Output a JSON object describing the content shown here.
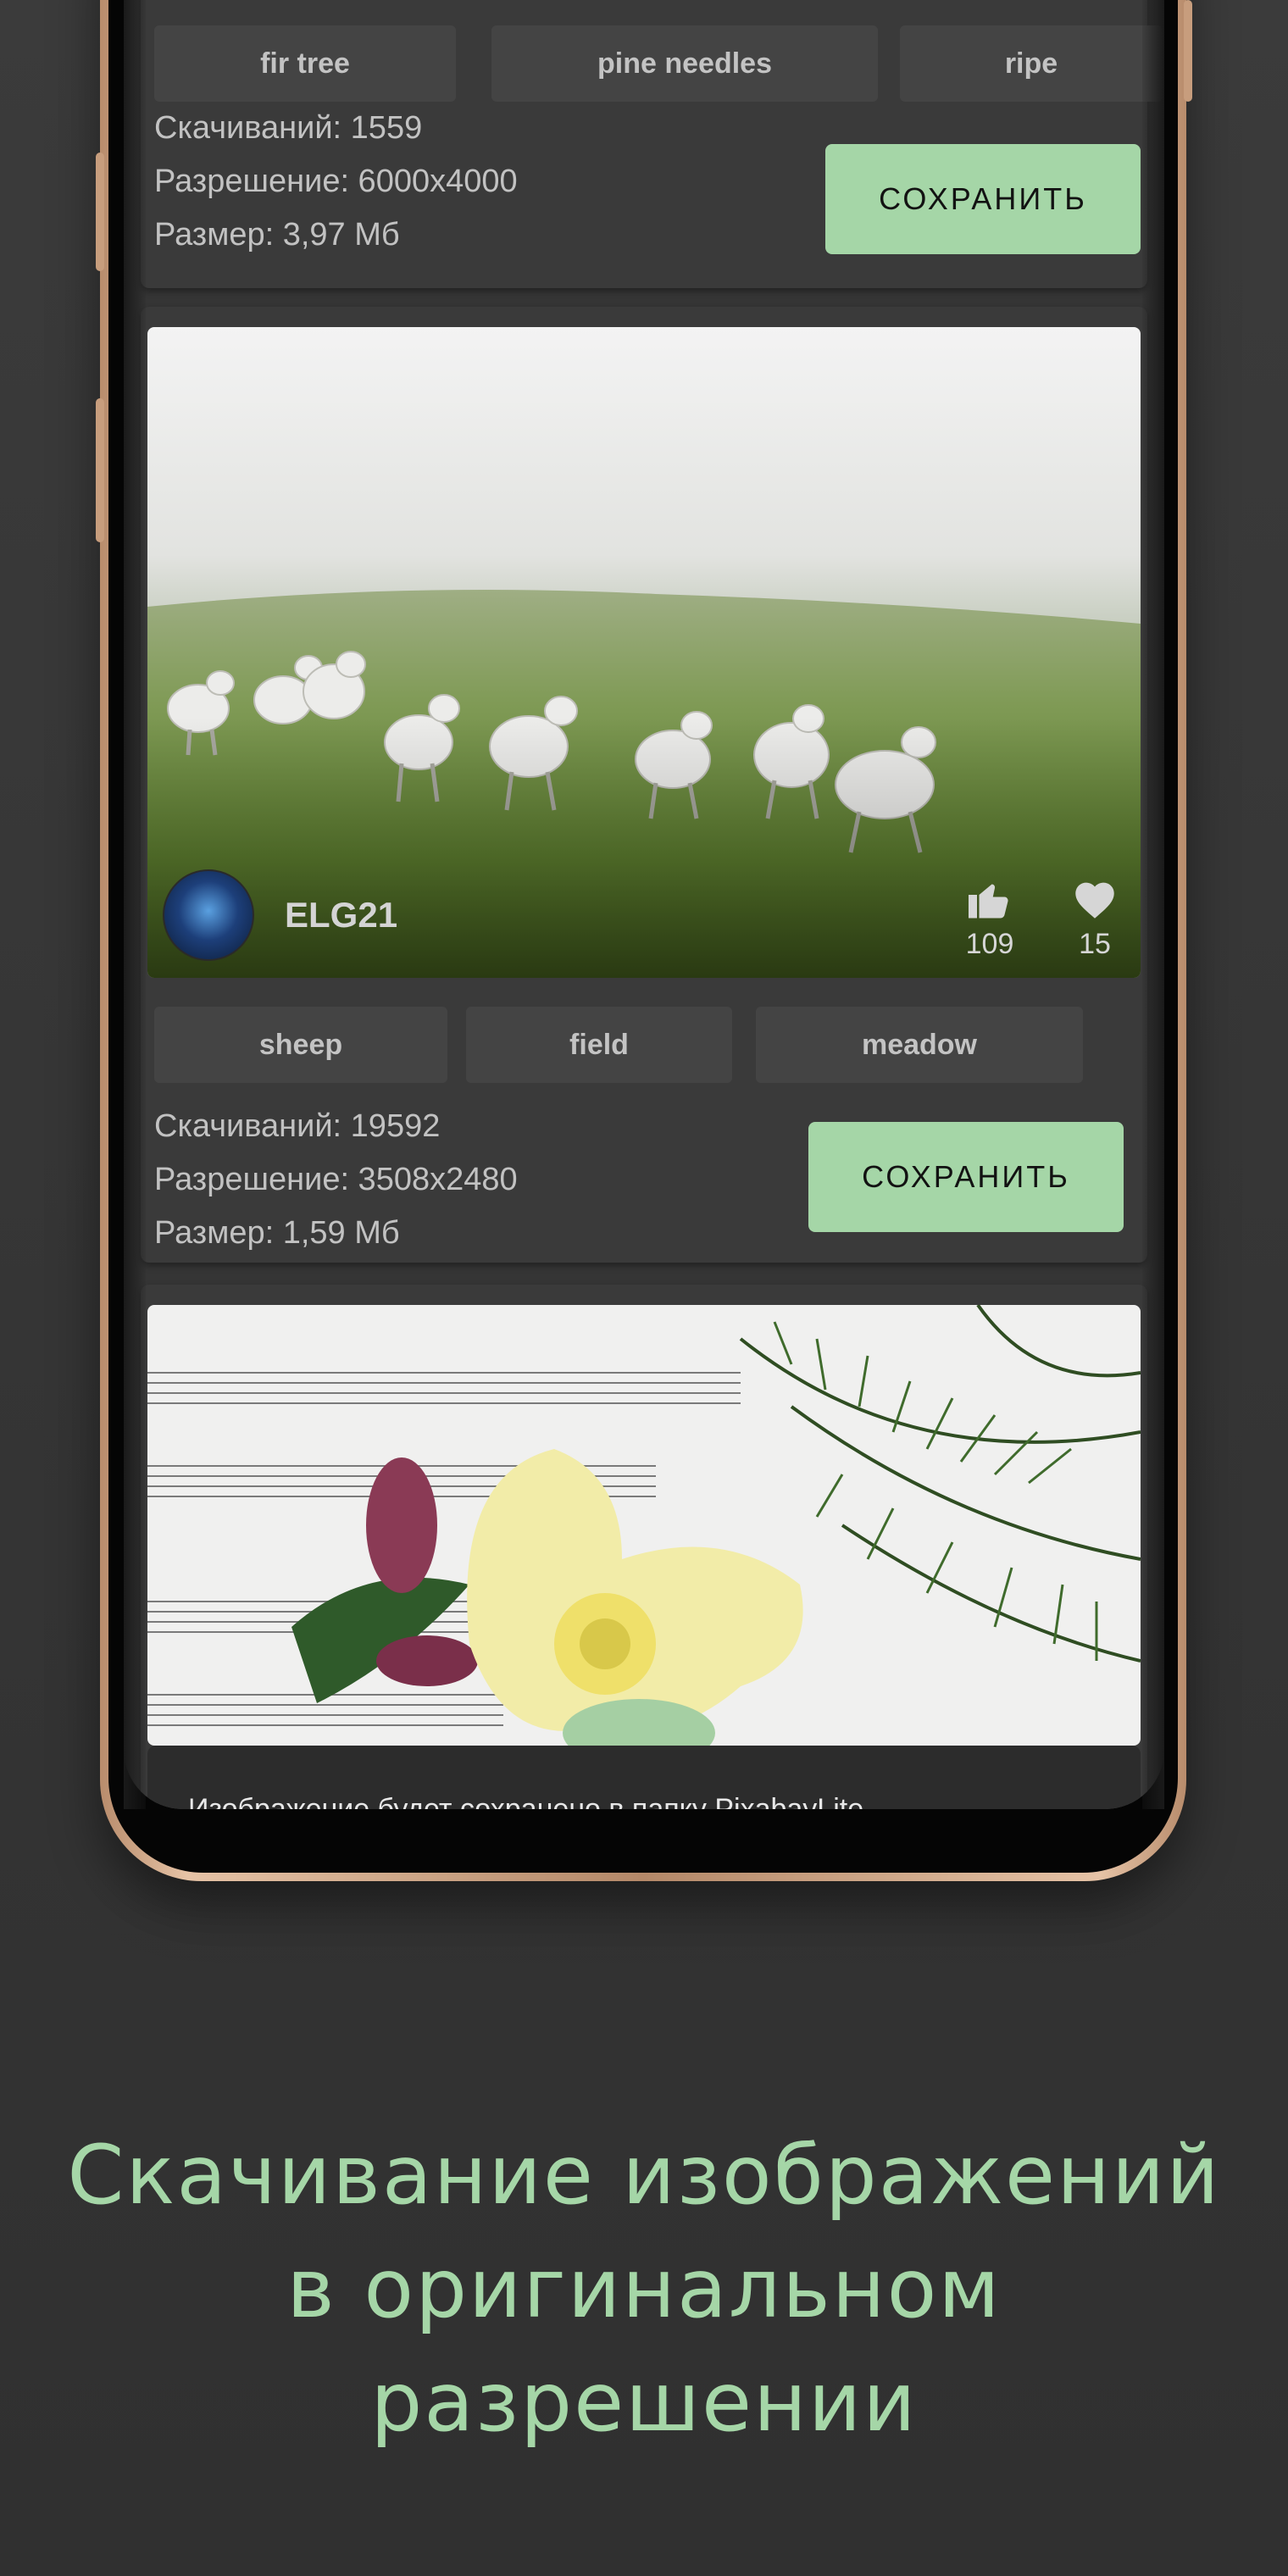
{
  "cards": [
    {
      "tags": [
        "fir tree",
        "pine needles",
        "ripe"
      ],
      "downloads": "Скачиваний: 1559",
      "resolution": "Разрешение: 6000x4000",
      "size": "Размер: 3,97 Мб",
      "save_label": "СОХРАНИТЬ"
    },
    {
      "username": "ELG21",
      "likes": "109",
      "favorites": "15",
      "tags": [
        "sheep",
        "field",
        "meadow"
      ],
      "downloads": "Скачиваний: 19592",
      "resolution": "Разрешение: 3508x2480",
      "size": "Размер: 1,59 Мб",
      "save_label": "СОХРАНИТЬ"
    }
  ],
  "snackbar": "Изображение будет сохранено в папку PixabayLite",
  "headline": [
    "Скачивание изображений",
    "в оригинальном",
    "разрешении"
  ],
  "colors": {
    "accent": "#a5d6a7",
    "background": "#353535",
    "card": "#3a3a3a"
  },
  "icons": [
    "thumb-up-icon",
    "heart-icon"
  ]
}
